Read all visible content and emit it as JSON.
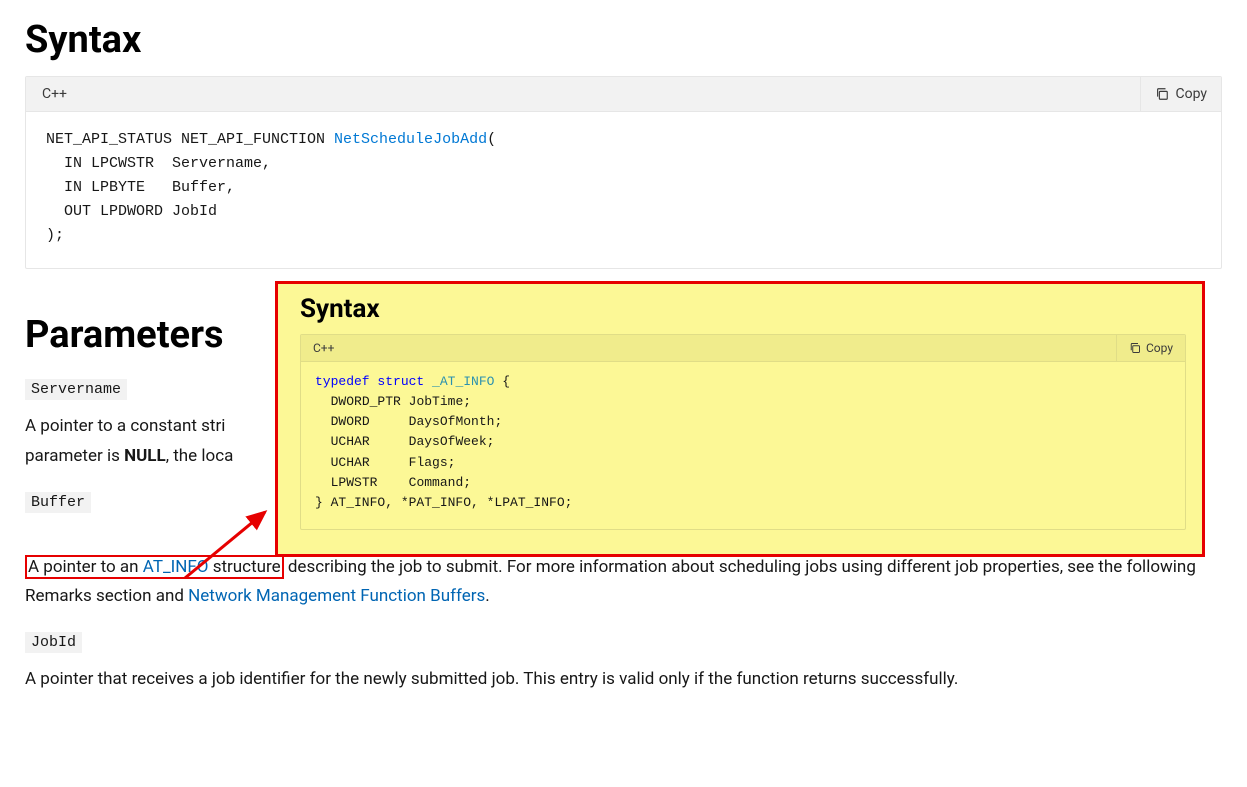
{
  "headings": {
    "syntax": "Syntax",
    "parameters": "Parameters"
  },
  "code": {
    "lang": "C++",
    "copy": "Copy",
    "main_prefix": "NET_API_STATUS NET_API_FUNCTION ",
    "main_fn": "NetScheduleJobAdd",
    "main_open": "(",
    "main_line1": "  IN LPCWSTR  Servername,",
    "main_line2": "  IN LPBYTE   Buffer,",
    "main_line3": "  OUT LPDWORD JobId",
    "main_close": ");"
  },
  "params": {
    "servername": {
      "code": "Servername",
      "desc_prefix": "A pointer to a constant stri",
      "desc_line2_prefix": "parameter is ",
      "desc_line2_bold": "NULL",
      "desc_line2_suffix": ", the loca"
    },
    "buffer": {
      "code": "Buffer",
      "boxed_prefix": "A pointer to an ",
      "boxed_link": "AT_INFO",
      "boxed_suffix": " structure",
      "desc_after_box": " describing the job to submit. For more information about scheduling jobs using different job properties, see the following Remarks section and ",
      "desc_link2": "Network Management Function Buffers",
      "desc_period": "."
    },
    "jobid": {
      "code": "JobId",
      "desc": "A pointer that receives a job identifier for the newly submitted job. This entry is valid only if the function returns successfully."
    }
  },
  "overlay": {
    "heading": "Syntax",
    "lang": "C++",
    "copy": "Copy",
    "kw_typedef": "typedef",
    "kw_struct": "struct",
    "struct_name": "_AT_INFO",
    "open": " {",
    "m1_t": "DWORD_PTR",
    "m1_n": "JobTime;",
    "m2_t": "DWORD",
    "m2_n": "DaysOfMonth;",
    "m3_t": "UCHAR",
    "m3_n": "DaysOfWeek;",
    "m4_t": "UCHAR",
    "m4_n": "Flags;",
    "m5_t": "LPWSTR",
    "m5_n": "Command;",
    "close": "} AT_INFO, *PAT_INFO, *LPAT_INFO;"
  }
}
